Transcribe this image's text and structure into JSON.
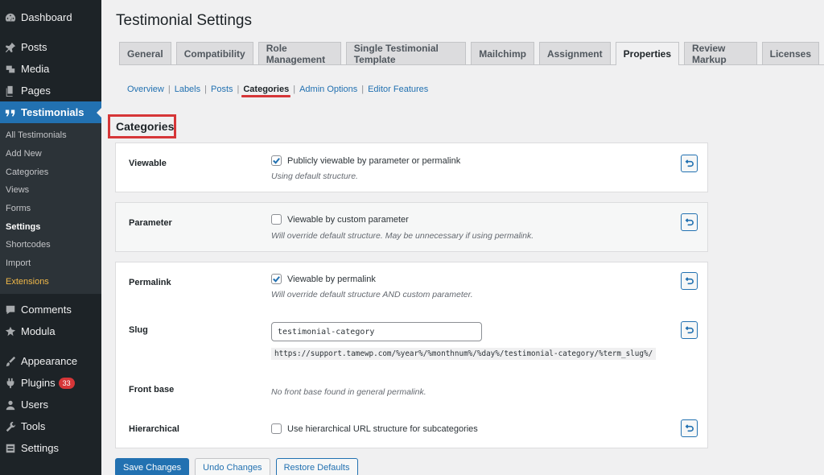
{
  "sidebar": {
    "top_items": [
      {
        "label": "Dashboard",
        "icon": "dashboard-icon"
      },
      {
        "label": "Posts",
        "icon": "pin-icon"
      },
      {
        "label": "Media",
        "icon": "media-icon"
      },
      {
        "label": "Pages",
        "icon": "pages-icon"
      }
    ],
    "current": {
      "label": "Testimonials",
      "icon": "quote-icon"
    },
    "submenu": [
      "All Testimonials",
      "Add New",
      "Categories",
      "Views",
      "Forms",
      "Settings",
      "Shortcodes",
      "Import",
      "Extensions"
    ],
    "bottom_items": [
      {
        "label": "Comments",
        "icon": "comments-icon"
      },
      {
        "label": "Modula",
        "icon": "modula-icon"
      },
      {
        "label": "Appearance",
        "icon": "appearance-icon"
      },
      {
        "label": "Plugins",
        "icon": "plugins-icon",
        "badge": "33"
      },
      {
        "label": "Users",
        "icon": "users-icon"
      },
      {
        "label": "Tools",
        "icon": "tools-icon"
      },
      {
        "label": "Settings",
        "icon": "settings-icon"
      }
    ]
  },
  "page": {
    "title": "Testimonial Settings",
    "tabs": [
      "General",
      "Compatibility",
      "Role Management",
      "Single Testimonial Template",
      "Mailchimp",
      "Assignment",
      "Properties",
      "Review Markup",
      "Licenses"
    ],
    "active_tab": "Properties",
    "subnav": [
      "Overview",
      "Labels",
      "Posts",
      "Categories",
      "Admin Options",
      "Editor Features"
    ],
    "active_subnav": "Categories",
    "section_title": "Categories"
  },
  "viewable": {
    "label": "Viewable",
    "check_label": "Publicly viewable by parameter or permalink",
    "checked": true,
    "desc": "Using default structure."
  },
  "parameter": {
    "label": "Parameter",
    "check_label": "Viewable by custom parameter",
    "checked": false,
    "desc": "Will override default structure. May be unnecessary if using permalink."
  },
  "permalink": {
    "label": "Permalink",
    "check_label": "Viewable by permalink",
    "checked": true,
    "desc": "Will override default structure AND custom parameter."
  },
  "slug": {
    "label": "Slug",
    "value": "testimonial-category",
    "url": "https://support.tamewp.com/%year%/%monthnum%/%day%/testimonial-category/%term_slug%/"
  },
  "front_base": {
    "label": "Front base",
    "desc": "No front base found in general permalink."
  },
  "hierarchical": {
    "label": "Hierarchical",
    "check_label": "Use hierarchical URL structure for subcategories",
    "checked": false
  },
  "actions": {
    "save": "Save Changes",
    "undo": "Undo Changes",
    "restore": "Restore Defaults"
  },
  "colors": {
    "accent": "#2271b1",
    "highlight": "#d63638",
    "sidebar": "#1d2327"
  }
}
